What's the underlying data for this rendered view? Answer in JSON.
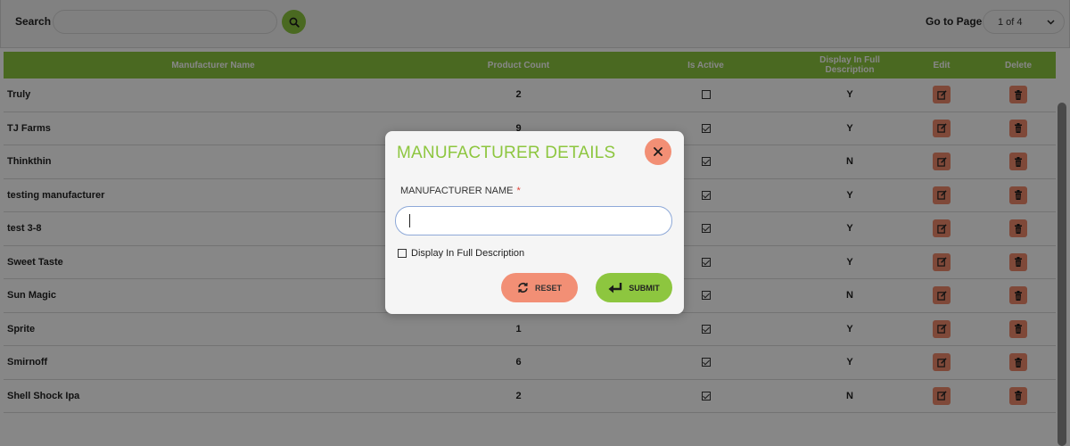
{
  "toolbar": {
    "search_label": "Search",
    "search_value": "",
    "goto_label": "Go to Page",
    "page_selected": "1 of 4"
  },
  "table": {
    "headers": {
      "name": "Manufacturer Name",
      "count": "Product Count",
      "active": "Is Active",
      "display": "Display In Full Description",
      "edit": "Edit",
      "delete": "Delete"
    },
    "rows": [
      {
        "name": "Truly",
        "count": "2",
        "active": false,
        "display": "Y"
      },
      {
        "name": "TJ Farms",
        "count": "9",
        "active": true,
        "display": "Y"
      },
      {
        "name": "Thinkthin",
        "count": "",
        "active": true,
        "display": "N"
      },
      {
        "name": "testing manufacturer",
        "count": "",
        "active": true,
        "display": "Y"
      },
      {
        "name": "test 3-8",
        "count": "",
        "active": true,
        "display": "Y"
      },
      {
        "name": "Sweet Taste",
        "count": "",
        "active": true,
        "display": "Y"
      },
      {
        "name": "Sun Magic",
        "count": "",
        "active": true,
        "display": "N"
      },
      {
        "name": "Sprite",
        "count": "1",
        "active": true,
        "display": "Y"
      },
      {
        "name": "Smirnoff",
        "count": "6",
        "active": true,
        "display": "Y"
      },
      {
        "name": "Shell Shock Ipa",
        "count": "2",
        "active": true,
        "display": "N"
      }
    ]
  },
  "modal": {
    "title": "MANUFACTURER DETAILS",
    "name_label": "MANUFACTURER NAME",
    "required_mark": "*",
    "name_value": "",
    "display_label": "Display In Full Description",
    "display_checked": false,
    "reset_label": "RESET",
    "submit_label": "SUBMIT"
  },
  "colors": {
    "accent_green": "#8dc63f",
    "accent_salmon": "#f28f75",
    "overlay": "rgba(0,0,0,0.47)"
  },
  "icons": {
    "search": "search-icon",
    "chevron": "chevron-down-icon",
    "edit": "edit-icon",
    "delete": "trash-icon",
    "close": "close-icon",
    "reset": "refresh-icon",
    "submit": "enter-icon"
  }
}
